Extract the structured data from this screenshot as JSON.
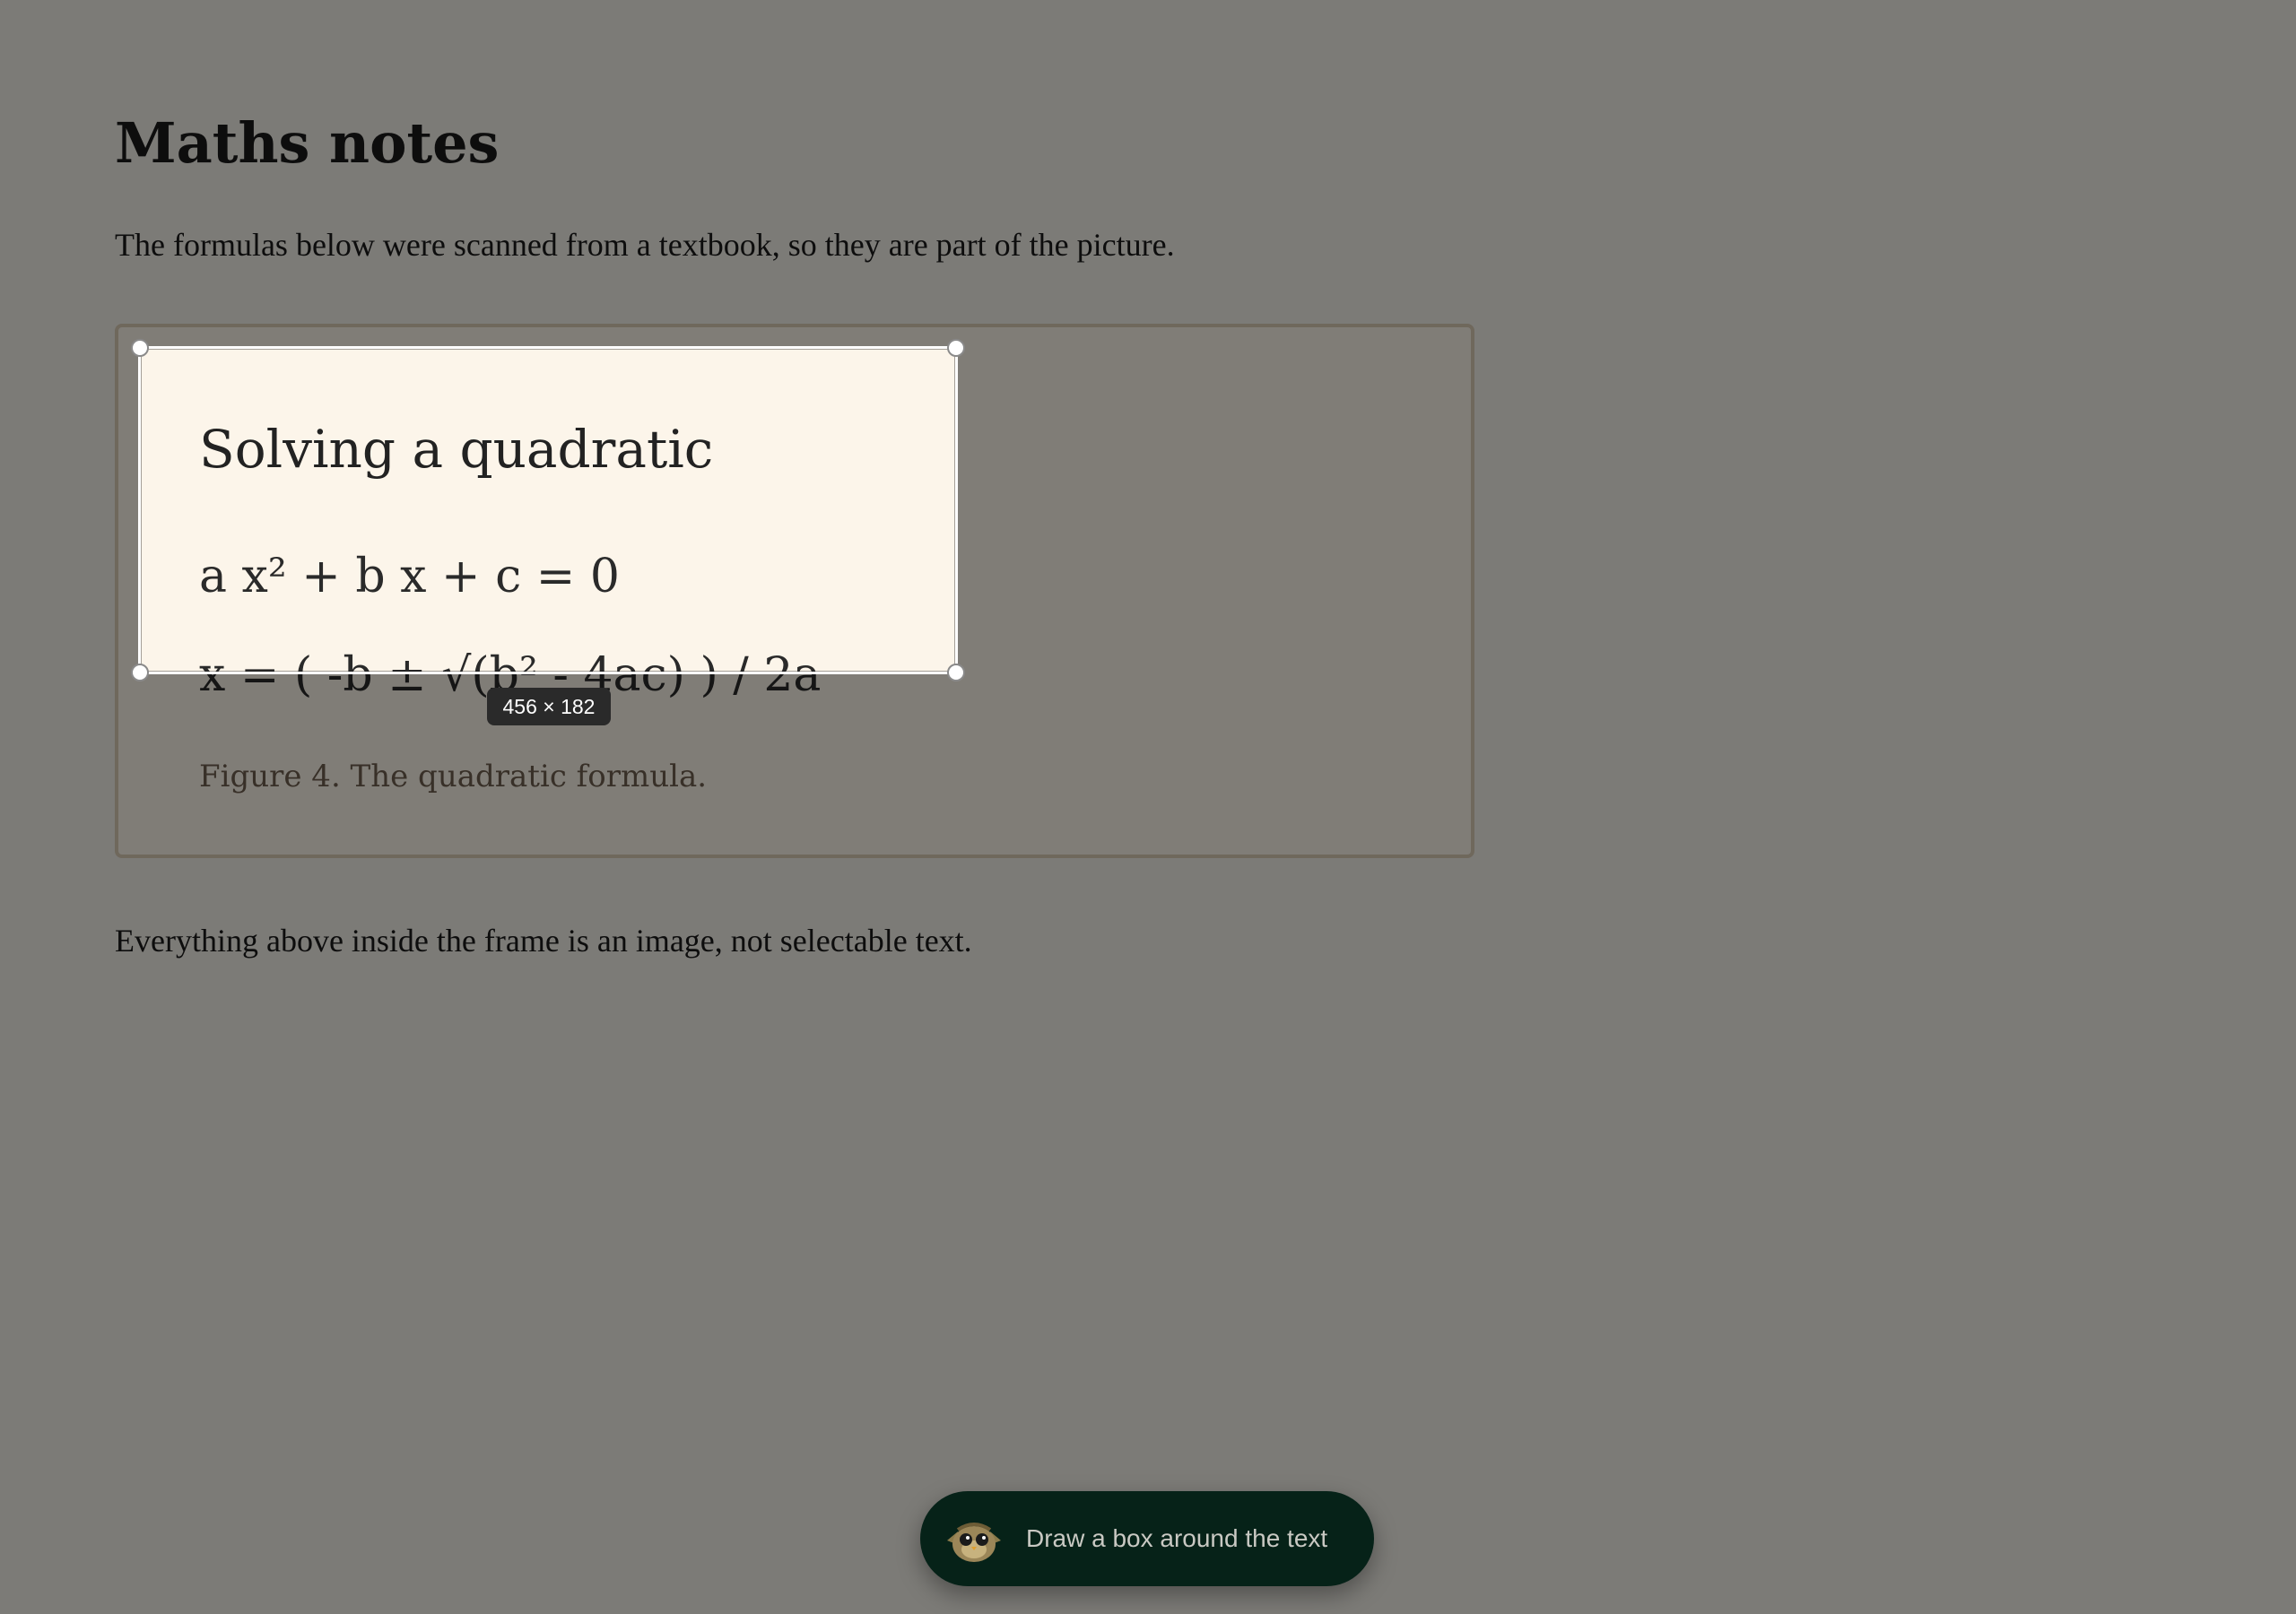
{
  "document": {
    "title": "Maths notes",
    "intro": "The formulas below were scanned from a textbook, so they are part of the picture.",
    "outro": "Everything above inside the frame is an image, not selectable text."
  },
  "scanned_figure": {
    "heading": "Solving a quadratic",
    "equation_1": "a x² + b x + c = 0",
    "equation_2": "x = ( -b ± √(b² - 4ac) ) / 2a",
    "caption": "Figure 4. The quadratic formula."
  },
  "selection_tool": {
    "size_label": "456 × 182",
    "handles": [
      "top-left",
      "top-right",
      "bottom-left",
      "bottom-right"
    ]
  },
  "instruction_pill": {
    "text": "Draw a box around the text",
    "icon": "mascot-icon"
  },
  "colors": {
    "page_background": "#f4f1ea",
    "figure_background": "#fcf5ea",
    "overlay": "rgba(0,0,0,0.49)",
    "pill_background": "#062218",
    "selection_border": "#ffffff"
  }
}
